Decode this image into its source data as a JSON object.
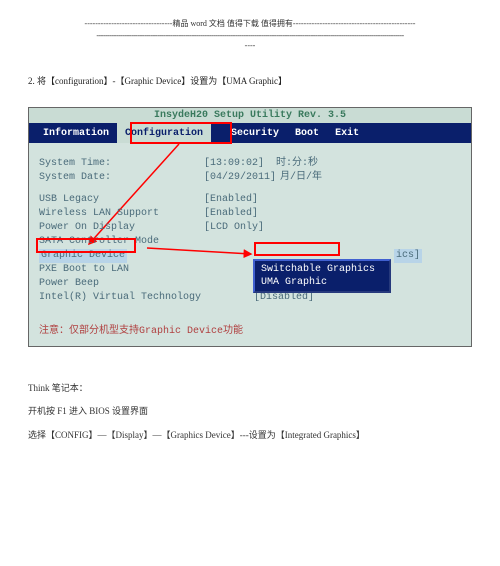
{
  "header": {
    "line1": "---------------------------------精品 word 文档 值得下载 值得拥有----------------------------------------------",
    "line2": "----------------------------------------------------------------------------------------------------------------------------------------------",
    "line3": "----"
  },
  "step": "2. 将【configuration】-【Graphic Device】设置为【UMA Graphic】",
  "bios": {
    "title": "InsydeH20 Setup Utility Rev. 3.5",
    "tabs": {
      "info": "Information",
      "cfg": "Configuration",
      "sec": "Security",
      "boot": "Boot",
      "exit": "Exit"
    },
    "rows": {
      "systime_l": "System Time:",
      "systime_v": "[13:09:02]",
      "systime_n": "时:分:秒",
      "sysdate_l": "System Date:",
      "sysdate_v": "[04/29/2011]",
      "sysdate_n": "月/日/年",
      "usb_l": "USB Legacy",
      "usb_v": "[Enabled]",
      "wlan_l": "Wireless LAN Support",
      "wlan_v": "[Enabled]",
      "pod_l": "Power On Display",
      "pod_v": "[LCD Only]",
      "sata_l": "SATA Controller Mode",
      "sata_v": "",
      "gd_l": "Graphic Device",
      "gd_v": "ics]",
      "pxe_l": "PXE Boot to LAN",
      "pxe_v": "",
      "pb_l": "Power Beep",
      "pb_v": "",
      "vt_l": "Intel(R) Virtual Technology",
      "vt_v": "[Disabled]"
    },
    "dropdown": {
      "opt1": "Switchable Graphics",
      "opt2": "UMA Graphic"
    },
    "note": "注意：仅部分机型支持Graphic Device功能"
  },
  "post": {
    "l1": "Think 笔记本：",
    "l2": "开机按 F1 进入 BIOS 设置界面",
    "l3": "选择【CONFIG】—【Display】—【Graphics Device】---设置为【Integrated Graphics】"
  }
}
